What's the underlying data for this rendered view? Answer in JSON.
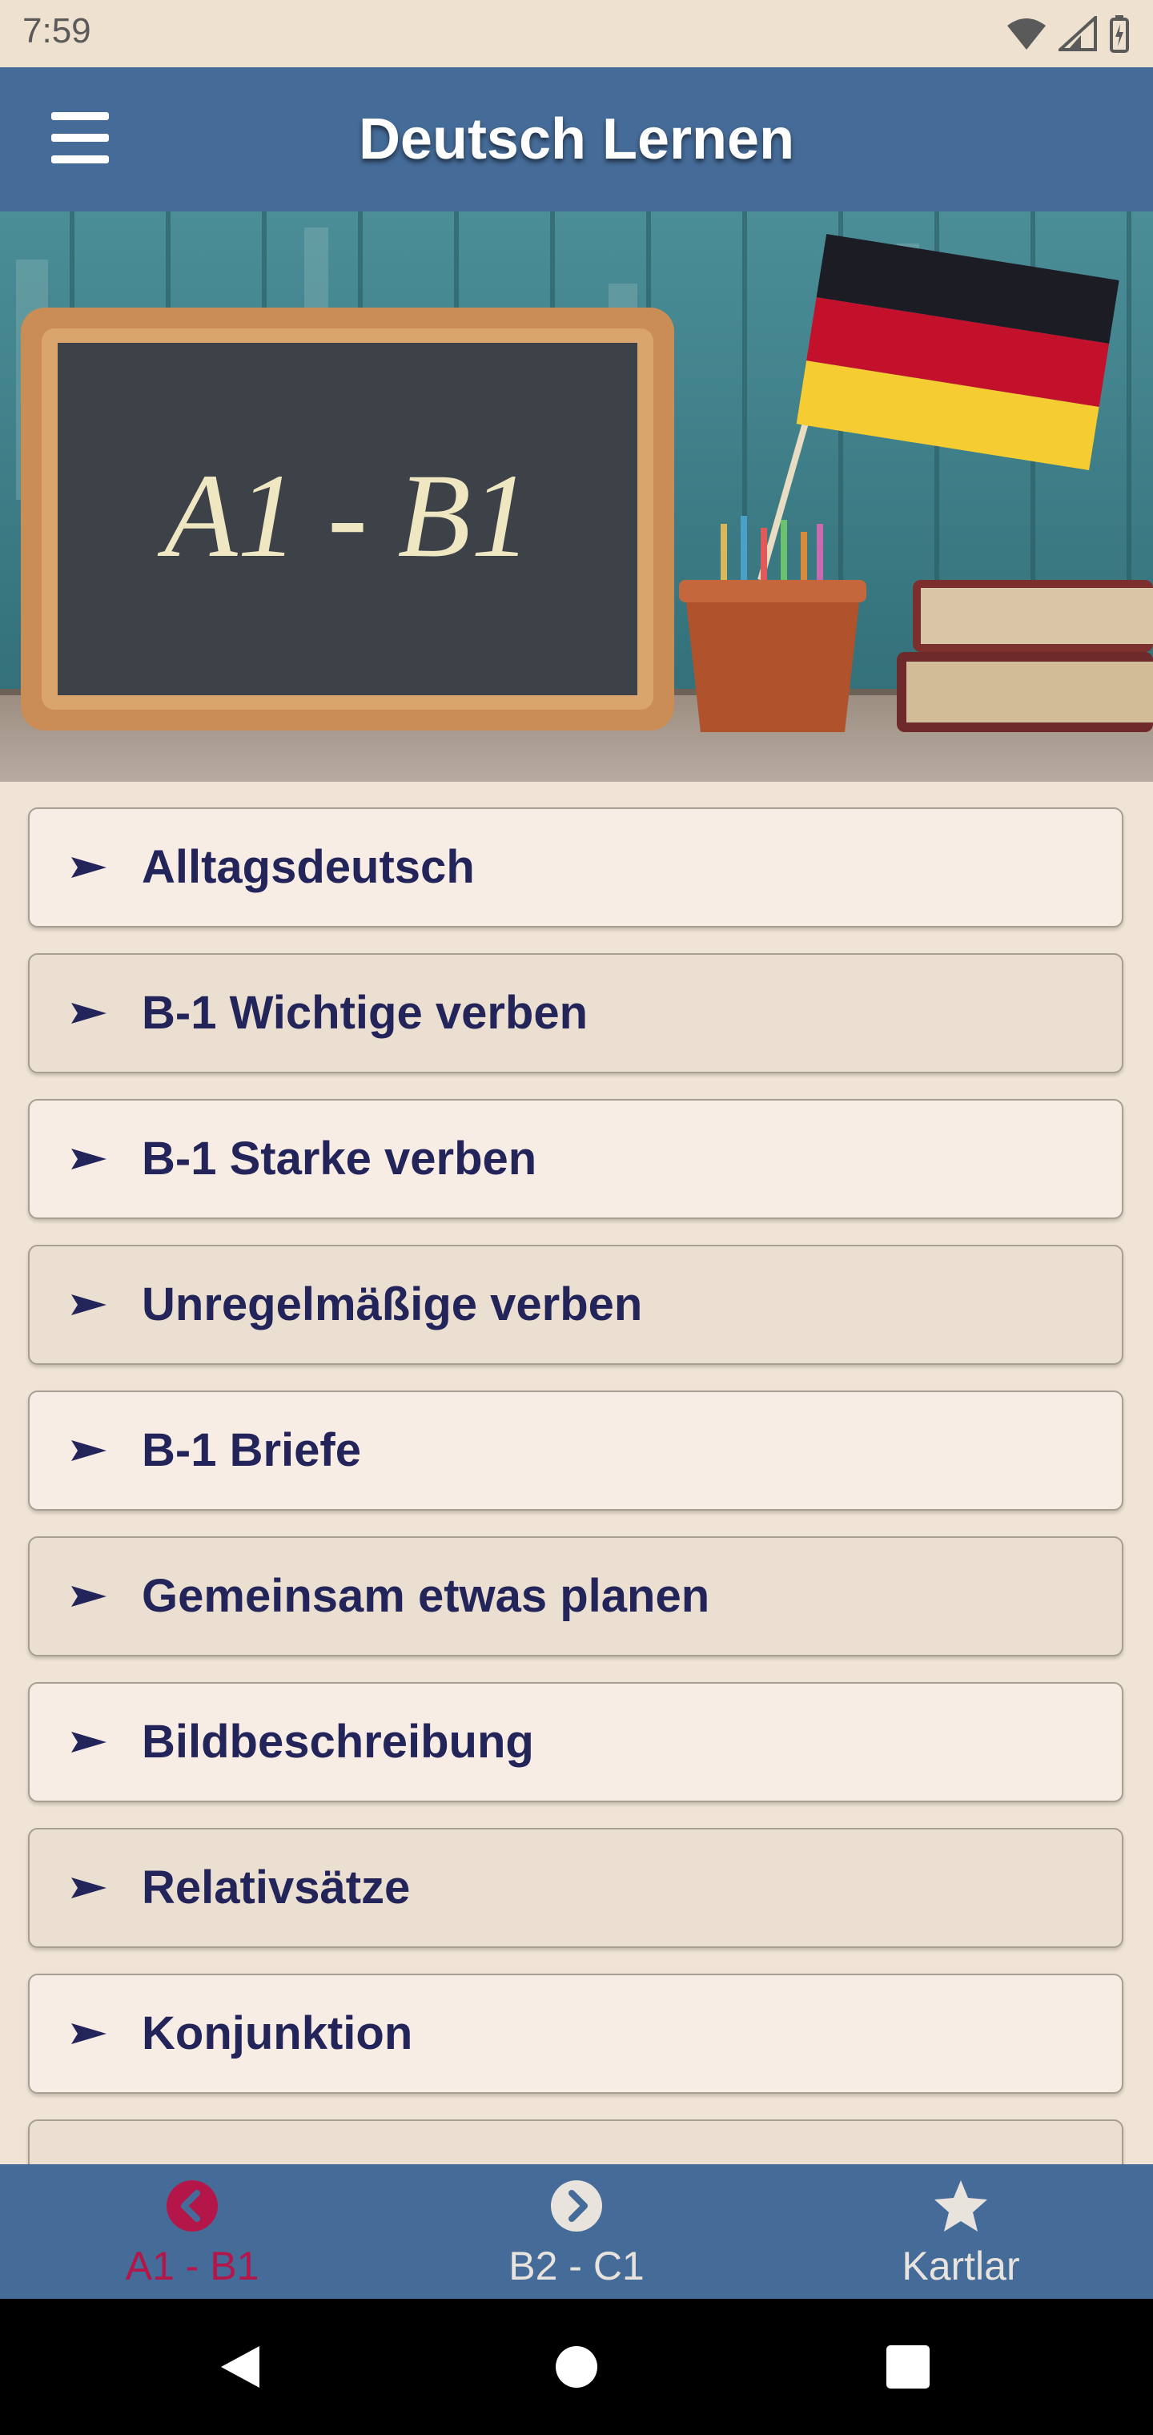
{
  "status_bar": {
    "time": "7:59",
    "icons": [
      "wifi-icon",
      "cell-signal-icon",
      "battery-icon"
    ]
  },
  "app_bar": {
    "title": "Deutsch Lernen",
    "menu_icon": "hamburger-menu-icon"
  },
  "banner": {
    "chalkboard_text": "A1 - B1"
  },
  "menu_items": [
    {
      "label": "Alltagsdeutsch"
    },
    {
      "label": "B-1 Wichtige verben"
    },
    {
      "label": "B-1 Starke verben"
    },
    {
      "label": "Unregelmäßige verben"
    },
    {
      "label": "B-1 Briefe"
    },
    {
      "label": "Gemeinsam etwas planen"
    },
    {
      "label": "Bildbeschreibung"
    },
    {
      "label": "Relativsätze"
    },
    {
      "label": "Konjunktion"
    },
    {
      "label": ""
    }
  ],
  "bottom_nav": {
    "tabs": [
      {
        "label": "A1 - B1",
        "icon": "chevron-left-circle-icon",
        "active": true
      },
      {
        "label": "B2 - C1",
        "icon": "chevron-right-circle-icon",
        "active": false
      },
      {
        "label": "Kartlar",
        "icon": "star-icon",
        "active": false
      }
    ]
  },
  "colors": {
    "app_bar": "#456b98",
    "active_tab": "#b4164a",
    "item_text": "#22245a",
    "item_light": "#f8ede4",
    "item_dark": "#eadfd0"
  }
}
